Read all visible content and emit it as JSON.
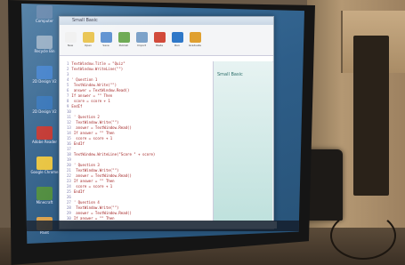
{
  "window": {
    "title": "Small Basic",
    "toolbar": [
      {
        "label": "New",
        "icon": "new-file-icon",
        "color": "#f0f0f0"
      },
      {
        "label": "Open",
        "icon": "folder-icon",
        "color": "#e8c24a"
      },
      {
        "label": "Save",
        "icon": "save-icon",
        "color": "#5a8fd0"
      },
      {
        "label": "Publish",
        "icon": "publish-icon",
        "color": "#6aa84f"
      },
      {
        "label": "Import",
        "icon": "import-icon",
        "color": "#7aa0c8"
      },
      {
        "label": "Paste",
        "icon": "paste-icon",
        "color": "#d24a3a"
      },
      {
        "label": "Run",
        "icon": "run-icon",
        "color": "#2f78c8"
      },
      {
        "label": "Graduate",
        "icon": "graduate-icon",
        "color": "#e0a030"
      }
    ],
    "editor_lines": [
      "TextWindow.Title = \"Quiz\"",
      "TextWindow.WriteLine(\"\")",
      "",
      "' Question 1",
      "  TextWindow.Write(\"\")",
      "  answer = TextWindow.Read()",
      "If answer = \"\" Then",
      "  score = score + 1",
      "EndIf",
      "",
      "' Question 2",
      "  TextWindow.Write(\"\")",
      "  answer = TextWindow.Read()",
      "If answer = \"\" Then",
      "  score = score + 1",
      "EndIf",
      "",
      "TextWindow.WriteLine(\"Score \" + score)",
      "",
      "' Question 3",
      "  TextWindow.Write(\"\")",
      "  answer = TextWindow.Read()",
      "If answer = \"\" Then",
      "  score = score + 1",
      "EndIf",
      "",
      "' Question 4",
      "  TextWindow.Write(\"\")",
      "  answer = TextWindow.Read()",
      "If answer = \"\" Then",
      "EndIf"
    ],
    "help_title": "Small Basic"
  },
  "desktop_icons": [
    {
      "label": "Computer",
      "icon": "computer-icon",
      "color": "#5b7ea6"
    },
    {
      "label": "Recycle Bin",
      "icon": "recycle-bin-icon",
      "color": "#8fa8c0"
    },
    {
      "label": "2D Design V2",
      "icon": "design-icon",
      "color": "#3a7bc8"
    },
    {
      "label": "2D Design V2",
      "icon": "design-icon",
      "color": "#2e6fb5"
    },
    {
      "label": "Adobe Reader",
      "icon": "pdf-icon",
      "color": "#c0302a"
    },
    {
      "label": "Google Chrome",
      "icon": "chrome-icon",
      "color": "#e8c23a"
    },
    {
      "label": "Minecraft",
      "icon": "minecraft-icon",
      "color": "#4c8a3a"
    },
    {
      "label": "Paint",
      "icon": "paint-icon",
      "color": "#d9a04a"
    }
  ]
}
